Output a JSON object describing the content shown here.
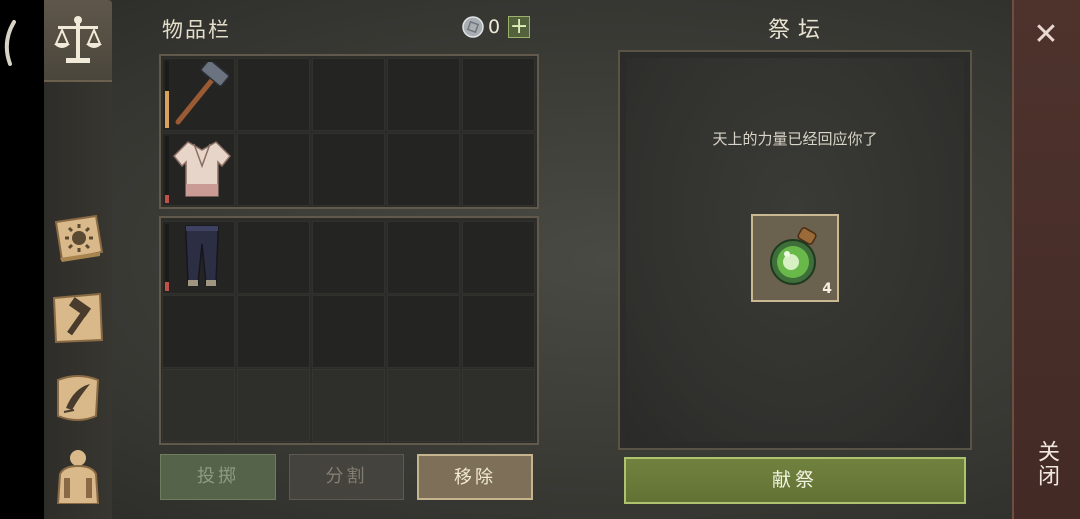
{
  "inventory": {
    "title": "物品栏",
    "currency_value": "0",
    "items": [
      {
        "name": "sledgehammer",
        "row": 0,
        "col": 0,
        "durability": 0.55,
        "durability_color": "#d9a15b"
      },
      {
        "name": "cloth-shirt",
        "row": 1,
        "col": 0,
        "durability": 0.12,
        "durability_color": "#c0504a"
      },
      {
        "name": "cloth-pants",
        "row": 2,
        "col": 0,
        "durability": 0.14,
        "durability_color": "#c0504a"
      }
    ]
  },
  "buttons": {
    "throw": "投掷",
    "split": "分割",
    "remove": "移除"
  },
  "altar": {
    "title": "祭坛",
    "message": "天上的力量已经回应你了",
    "item_count": "4",
    "offer_label": "献祭"
  },
  "close": {
    "icon": "close-icon",
    "label": "关闭"
  },
  "colors": {
    "accent_green": "#71823f",
    "close_red": "#4e332d",
    "remove_gold": "#c5b48e"
  }
}
